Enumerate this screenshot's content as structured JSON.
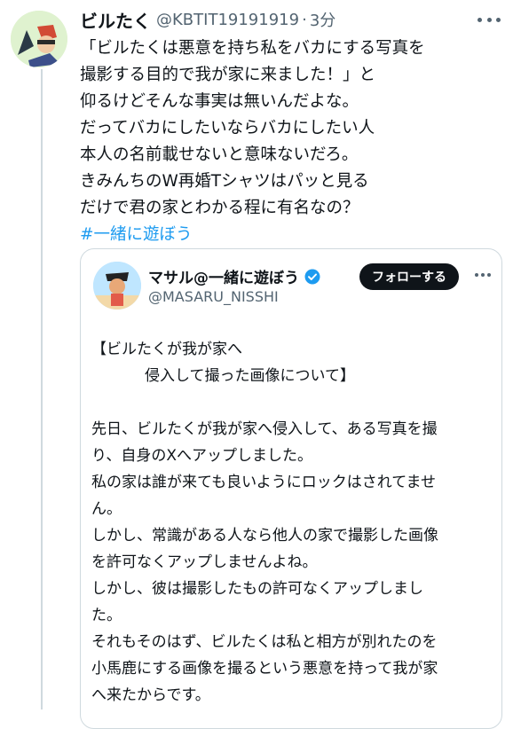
{
  "tweet": {
    "display_name": "ビルたく",
    "handle": "@KBTIT19191919",
    "separator": "·",
    "time": "3分",
    "lines": [
      "「ビルたくは悪意を持ち私をバカにする写真を",
      "撮影する目的で我が家に来ました！」と",
      "仰るけどそんな事実は無いんだよな。",
      "だってバカにしたいならバカにしたい人",
      "本人の名前載せないと意味ないだろ。",
      "きみんちのW再婚Tシャツはパッと見る",
      "だけで君の家とわかる程に有名なの？"
    ],
    "hashtag": "#一緒に遊ぼう"
  },
  "quote": {
    "display_name": "マサル@一緒に遊ぼう",
    "handle": "@MASARU_NISSHI",
    "follow_label": "フォローする",
    "lines": [
      "【ビルたくが我が家へ",
      "侵入して撮った画像について】",
      "",
      "先日、ビルたくが我が家へ侵入して、ある写真を撮",
      "り、自身のXへアップしました。",
      "私の家は誰が来ても良いようにロックはされてませ",
      "ん。",
      "しかし、常識がある人なら他人の家で撮影した画像",
      "を許可なくアップしませんよね。",
      "しかし、彼は撮影したもの許可なくアップしまし",
      "た。",
      "それもそのはず、ビルたくは私と相方が別れたのを",
      "小馬鹿にする画像を撮るという悪意を持って我が家",
      "へ来たからです。"
    ]
  },
  "colors": {
    "accent": "#1d9bf0",
    "secondary_text": "#536471",
    "follow_bg": "#0f1419"
  },
  "icons": [
    "more-icon",
    "verified-icon"
  ]
}
